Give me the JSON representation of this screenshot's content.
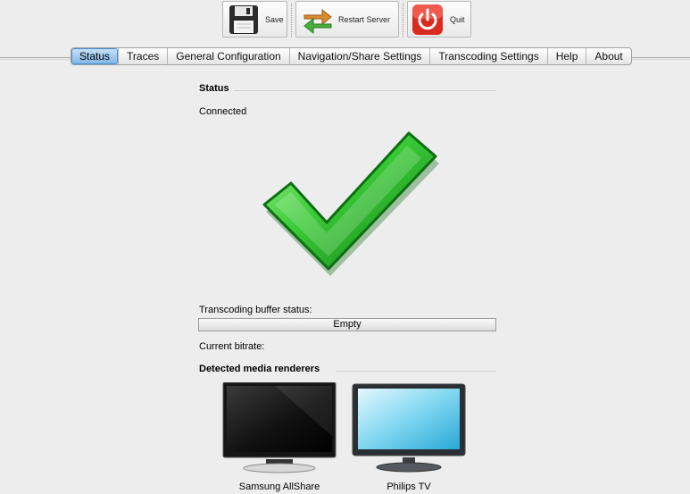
{
  "toolbar": {
    "save_label": "Save",
    "restart_label": "Restart Server",
    "quit_label": "Quit"
  },
  "tabs": [
    {
      "label": "Status",
      "active": true
    },
    {
      "label": "Traces"
    },
    {
      "label": "General Configuration"
    },
    {
      "label": "Navigation/Share Settings"
    },
    {
      "label": "Transcoding Settings"
    },
    {
      "label": "Help"
    },
    {
      "label": "About"
    }
  ],
  "status": {
    "section_title": "Status",
    "connection_text": "Connected",
    "buffer_label": "Transcoding buffer status:",
    "buffer_value": "Empty",
    "bitrate_label": "Current bitrate:",
    "renderers_title": "Detected media renderers"
  },
  "renderers": [
    {
      "name": "Samsung AllShare",
      "icon": "dark-tv-icon"
    },
    {
      "name": "Philips TV",
      "icon": "light-tv-icon"
    }
  ],
  "colors": {
    "active_tab": "#7fb4e6",
    "checkmark": "#2fb82f",
    "quit": "#d92b1e"
  }
}
